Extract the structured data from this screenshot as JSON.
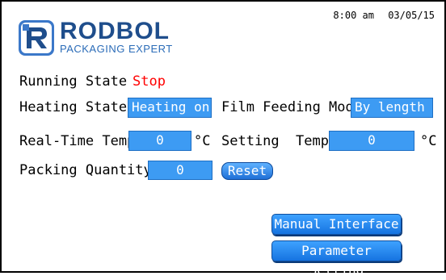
{
  "header": {
    "time": "8:00 am",
    "date": "03/05/15"
  },
  "brand": {
    "name": "RODBOL",
    "tagline": "PACKAGING EXPERT"
  },
  "running": {
    "label": "Running State",
    "value": "Stop",
    "value_color": "#ff0000"
  },
  "heating": {
    "label": "Heating State",
    "value": "Heating on"
  },
  "film": {
    "label": "Film Feeding Mode",
    "value": "By length"
  },
  "realtime_temp": {
    "label": "Real-Time Temp",
    "value": "0",
    "unit": "°C"
  },
  "setting_temp": {
    "label_a": "Setting",
    "label_b": "Temp",
    "value": "0",
    "unit": "°C"
  },
  "packing": {
    "label": "Packing Quantity",
    "value": "0",
    "reset_label": "Reset"
  },
  "buttons": {
    "manual": "Manual Interface",
    "parameter": "Parameter Setting"
  },
  "colors": {
    "accent": "#3d9bf3",
    "brand": "#1f4e8c",
    "status_stop": "#ff0000"
  }
}
